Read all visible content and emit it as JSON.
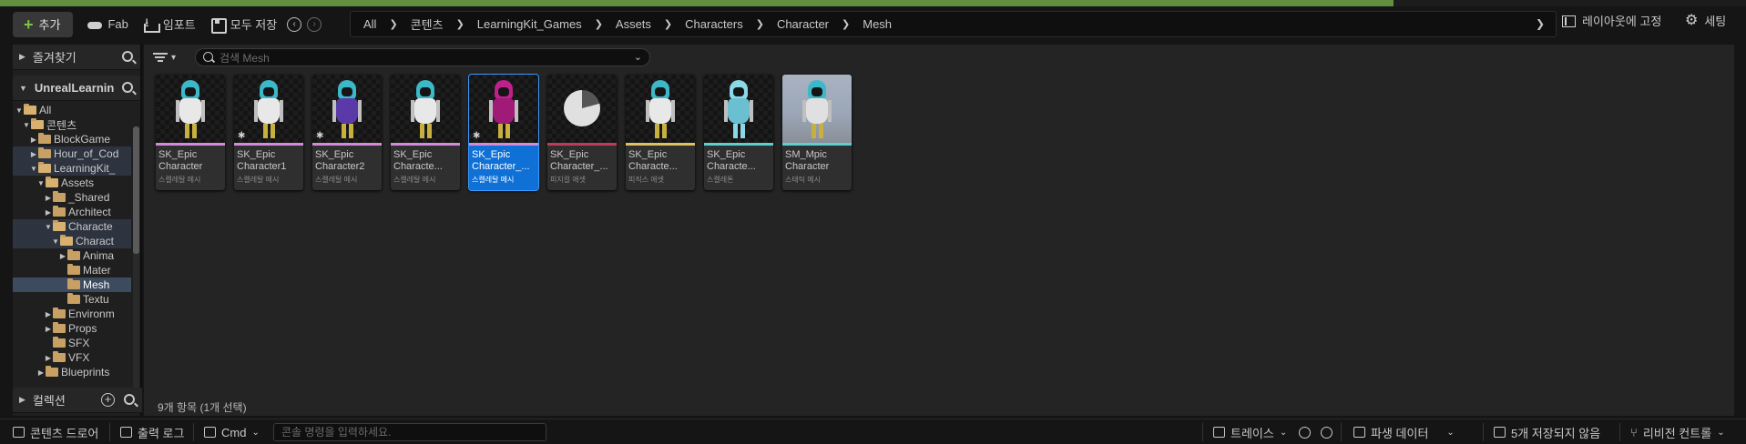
{
  "toolbar": {
    "add_label": "추가",
    "fab_label": "Fab",
    "import_label": "임포트",
    "save_all_label": "모두 저장",
    "lock_layout_label": "레이아웃에 고정",
    "settings_label": "세팅"
  },
  "breadcrumb": [
    "All",
    "콘텐츠",
    "LearningKit_Games",
    "Assets",
    "Characters",
    "Character",
    "Mesh"
  ],
  "left_panel": {
    "favorites_label": "즐겨찾기",
    "project_label": "UnrealLearning",
    "collections_label": "컬렉션",
    "tree": [
      {
        "label": "All",
        "depth": 0,
        "expanded": true
      },
      {
        "label": "콘텐츠",
        "depth": 1,
        "expanded": true
      },
      {
        "label": "BlockGame",
        "depth": 2,
        "expanded": false
      },
      {
        "label": "Hour_of_Cod",
        "depth": 2,
        "expanded": false
      },
      {
        "label": "LearningKit_",
        "depth": 2,
        "expanded": true
      },
      {
        "label": "Assets",
        "depth": 3,
        "expanded": true
      },
      {
        "label": "_Shared",
        "depth": 4,
        "expanded": false
      },
      {
        "label": "Architect",
        "depth": 4,
        "expanded": false
      },
      {
        "label": "Characte",
        "depth": 4,
        "expanded": true
      },
      {
        "label": "Charact",
        "depth": 5,
        "expanded": true
      },
      {
        "label": "Anima",
        "depth": 6,
        "expanded": false
      },
      {
        "label": "Mater",
        "depth": 6,
        "expanded": null
      },
      {
        "label": "Mesh",
        "depth": 6,
        "expanded": null,
        "selected": true
      },
      {
        "label": "Textu",
        "depth": 6,
        "expanded": null
      },
      {
        "label": "Environm",
        "depth": 4,
        "expanded": false
      },
      {
        "label": "Props",
        "depth": 4,
        "expanded": false
      },
      {
        "label": "SFX",
        "depth": 4,
        "expanded": null
      },
      {
        "label": "VFX",
        "depth": 4,
        "expanded": false
      },
      {
        "label": "Blueprints",
        "depth": 3,
        "expanded": false
      }
    ]
  },
  "search": {
    "placeholder": "검색 Mesh"
  },
  "assets": [
    {
      "name": "SK_Epic Character",
      "type": "스켈레탈 메시",
      "bar_color": "#d58ad9",
      "thumb": "cyan",
      "star": false,
      "selected": false
    },
    {
      "name": "SK_Epic Character1",
      "type": "스켈레탈 메시",
      "bar_color": "#d58ad9",
      "thumb": "cyan",
      "star": true,
      "selected": false
    },
    {
      "name": "SK_Epic Character2",
      "type": "스켈레탈 메시",
      "bar_color": "#d58ad9",
      "thumb": "purple",
      "star": true,
      "selected": false
    },
    {
      "name": "SK_Epic Characte...",
      "type": "스켈레탈 메시",
      "bar_color": "#d58ad9",
      "thumb": "cyan",
      "star": false,
      "selected": false
    },
    {
      "name": "SK_Epic Character_...",
      "type": "스켈레탈 메시",
      "bar_color": "#d58ad9",
      "thumb": "magenta",
      "star": true,
      "selected": true
    },
    {
      "name": "SK_Epic Character_...",
      "type": "피지컬 애셋",
      "bar_color": "#c23a5a",
      "thumb": "pie",
      "star": false,
      "selected": false
    },
    {
      "name": "SK_Epic Characte...",
      "type": "피직스 애셋",
      "bar_color": "#e0c060",
      "thumb": "cyan",
      "star": false,
      "selected": false
    },
    {
      "name": "SK_Epic Characte...",
      "type": "스켈레톤",
      "bar_color": "#5ad0d0",
      "thumb": "skeleton",
      "star": false,
      "selected": false
    },
    {
      "name": "SM_Mpic Character",
      "type": "스태틱 메시",
      "bar_color": "#5ad0d0",
      "thumb": "scene",
      "star": false,
      "selected": false
    }
  ],
  "status": {
    "count_text": "9개 항목 (1개 선택)"
  },
  "statusbar": {
    "content_drawer": "콘텐츠 드로어",
    "output_log": "출력 로그",
    "cmd_label": "Cmd",
    "cmd_placeholder": "콘솔 명령을 입력하세요.",
    "trace_label": "트레이스",
    "derived_data_label": "파생 데이터",
    "unsaved_label": "5개 저장되지 않음",
    "revision_control_label": "리비전 컨트롤"
  },
  "colors": {
    "accent_green": "#7ec24a",
    "selection_blue": "#0f70d6",
    "folder": "#c8a064"
  }
}
